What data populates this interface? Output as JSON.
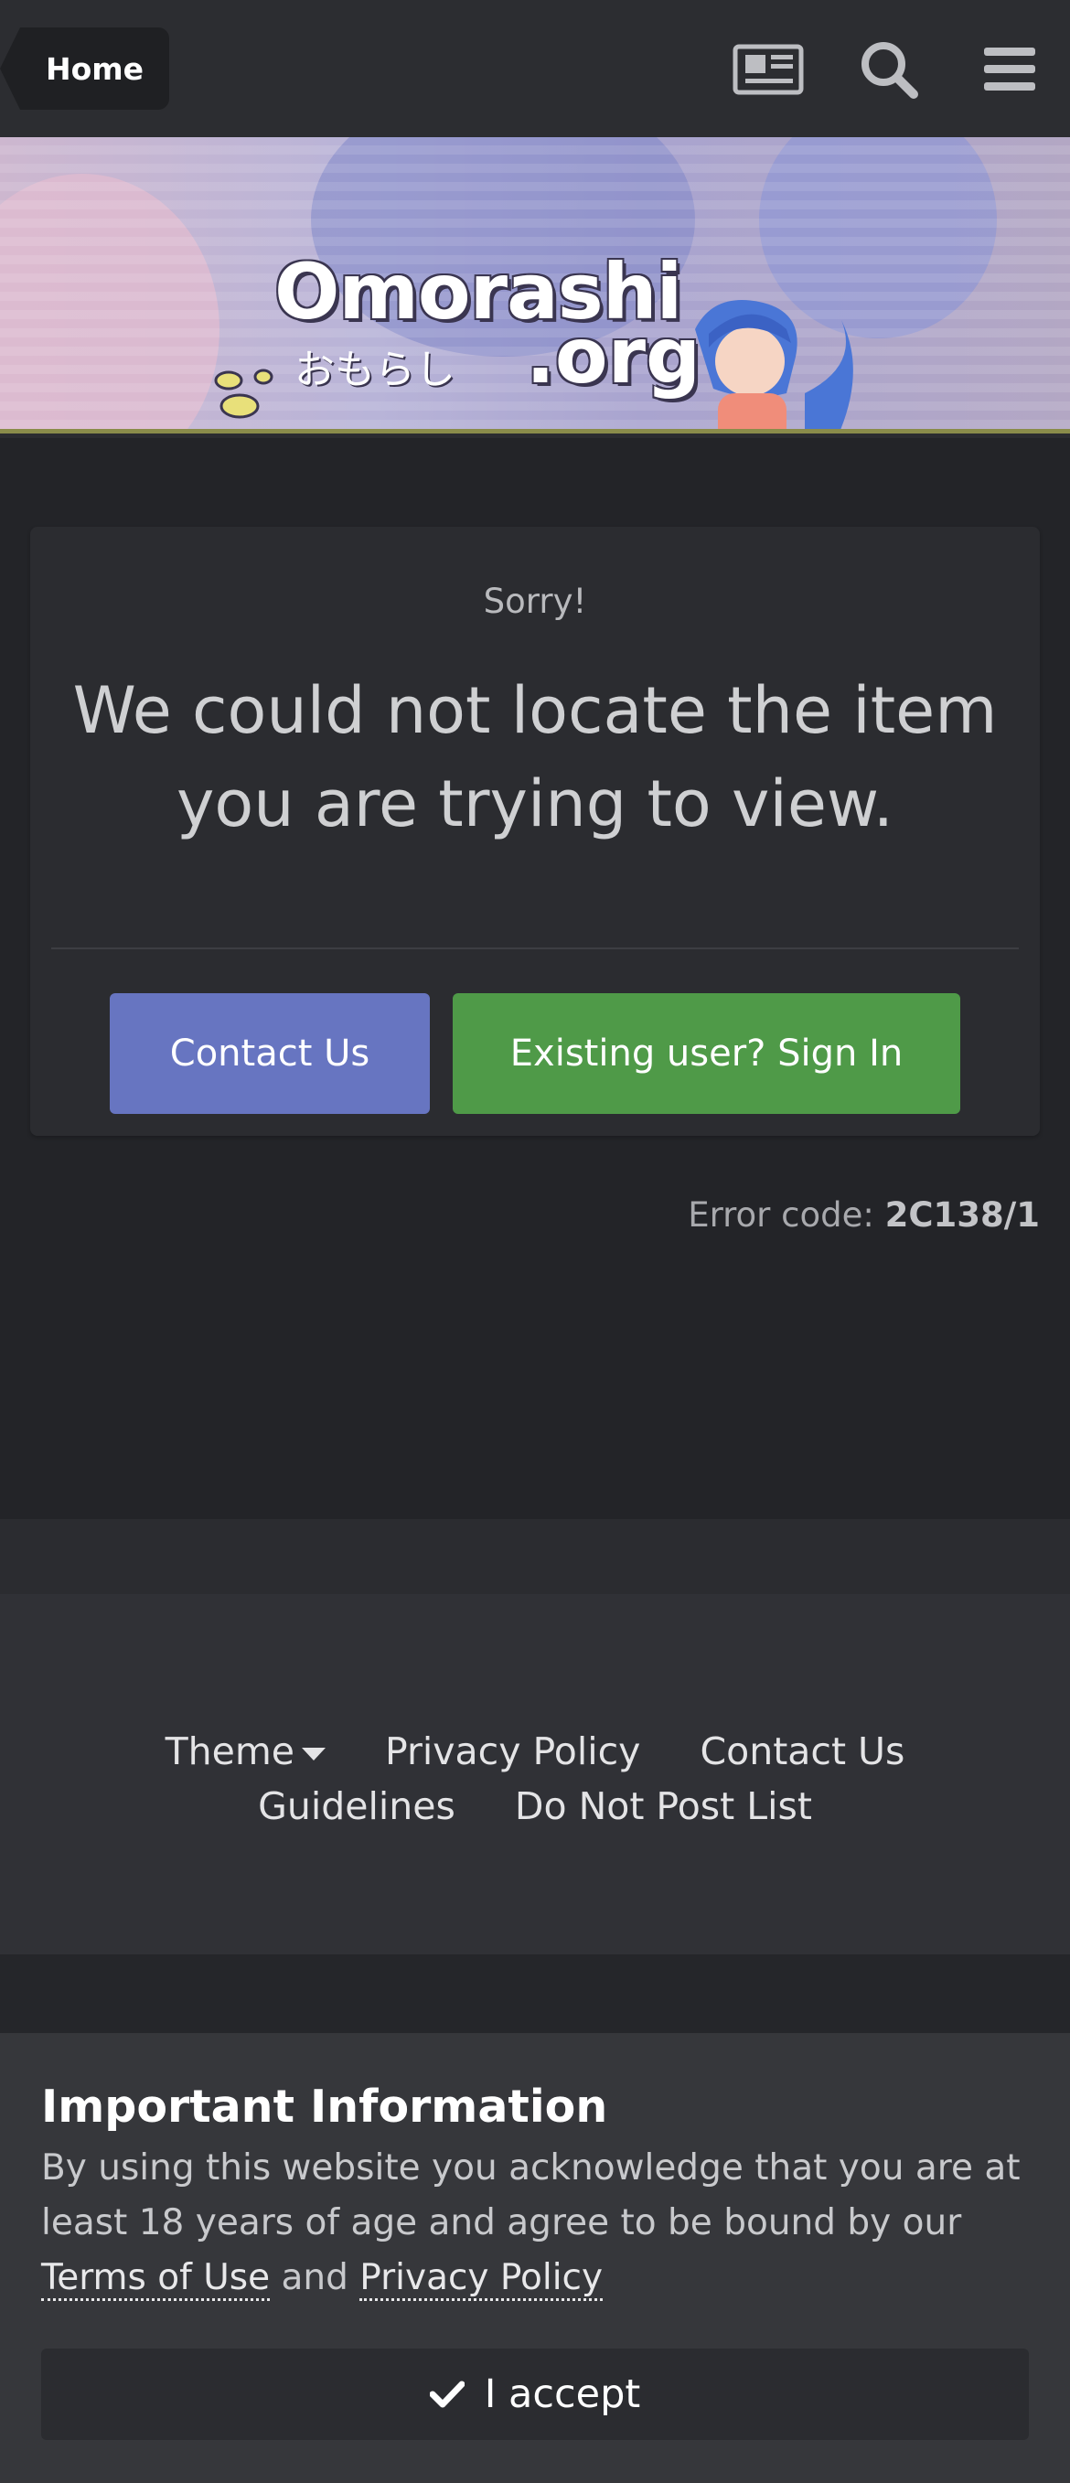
{
  "header": {
    "breadcrumb_home": "Home",
    "icons": [
      "activity-feed-icon",
      "search-icon",
      "menu-icon"
    ]
  },
  "banner": {
    "logo_text": "Omorashi",
    "logo_org": ".org",
    "logo_japanese": "おもらし"
  },
  "error_card": {
    "kicker": "Sorry!",
    "message": "We could not locate the item you are trying to view.",
    "contact_button": "Contact Us",
    "signin_button": "Existing user? Sign In"
  },
  "error_code": {
    "label": "Error code:",
    "code": "2C138/1"
  },
  "footer": {
    "links": [
      "Theme",
      "Privacy Policy",
      "Contact Us",
      "Guidelines",
      "Do Not Post List"
    ]
  },
  "notice": {
    "title": "Important Information",
    "text_before": "By using this website you acknowledge that you are at least 18 years of age and agree to be bound by our",
    "terms_link": "Terms of Use",
    "and": "and",
    "privacy_link": "Privacy Policy",
    "accept_button": "I accept"
  },
  "colors": {
    "contact_button": "#6775c1",
    "signin_button": "#4f9a48",
    "page_background": "#232428"
  }
}
